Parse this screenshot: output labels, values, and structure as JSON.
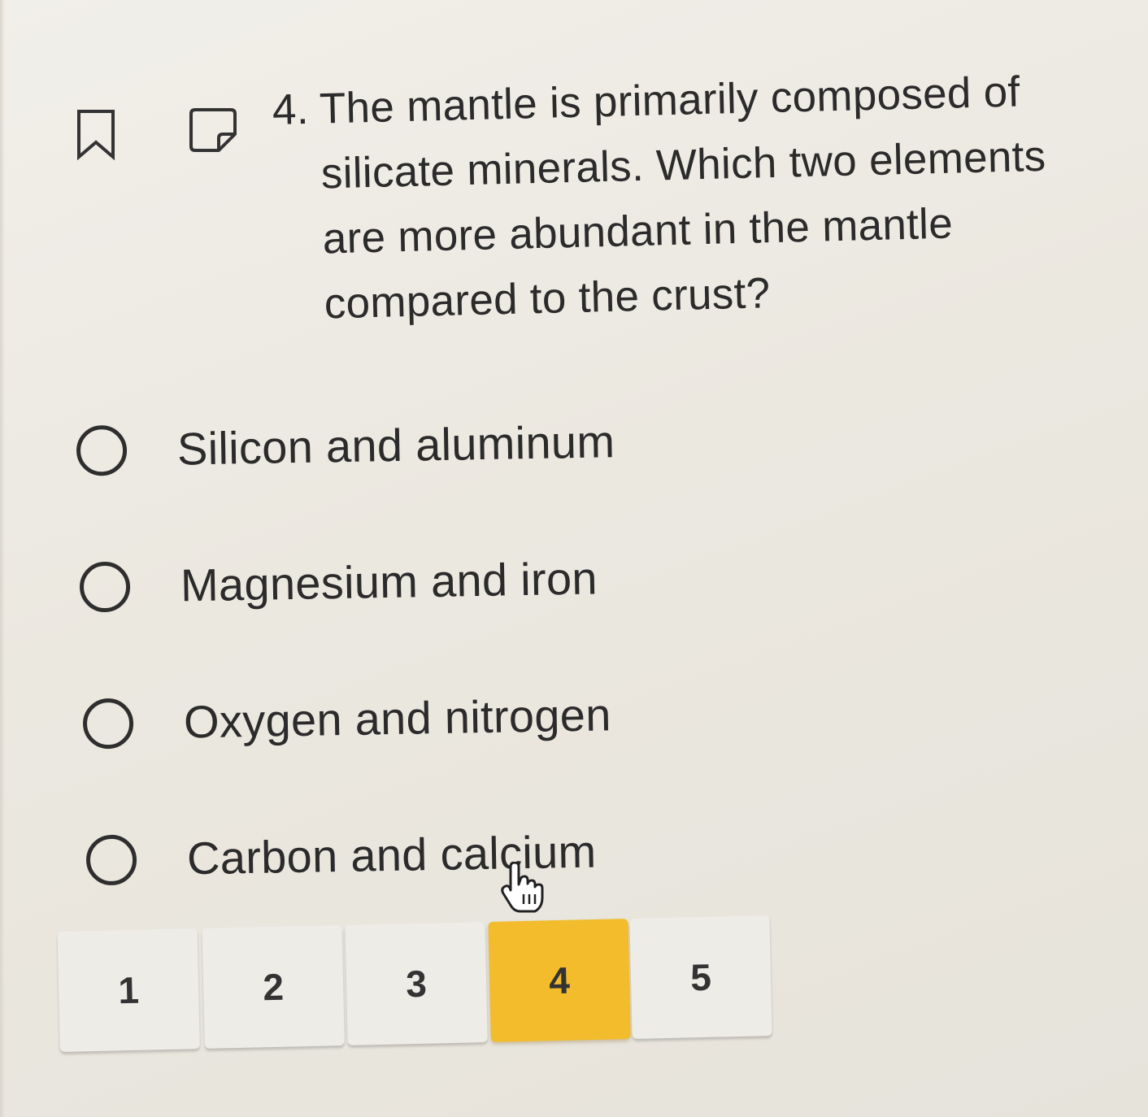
{
  "question": {
    "number": "4.",
    "text": "The mantle is primarily composed of silicate minerals. Which two elements are more abundant in the mantle compared to the crust?"
  },
  "icons": {
    "bookmark": "bookmark-icon",
    "note": "sticky-note-icon",
    "cursor": "hand-pointer-icon"
  },
  "choices": [
    {
      "label": "Silicon and aluminum",
      "selected": false
    },
    {
      "label": "Magnesium and iron",
      "selected": false
    },
    {
      "label": "Oxygen and nitrogen",
      "selected": false
    },
    {
      "label": "Carbon and calcium",
      "selected": false
    }
  ],
  "pagination": {
    "pages": [
      "1",
      "2",
      "3",
      "4",
      "5"
    ],
    "current": "4",
    "active_color": "#f2bc2d"
  }
}
